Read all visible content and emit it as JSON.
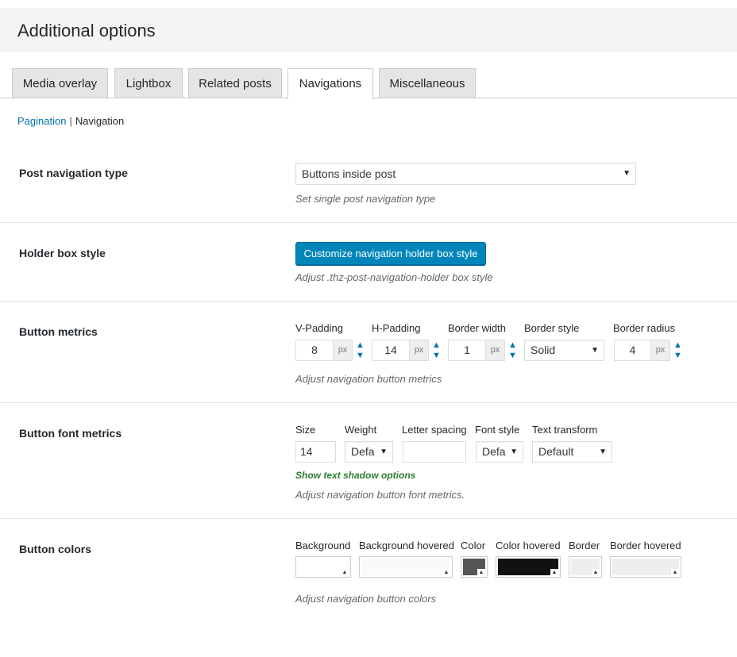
{
  "page_title": "Additional options",
  "tabs": [
    {
      "label": "Media overlay"
    },
    {
      "label": "Lightbox"
    },
    {
      "label": "Related posts"
    },
    {
      "label": "Navigations"
    },
    {
      "label": "Miscellaneous"
    }
  ],
  "subnav": {
    "pagination": "Pagination",
    "separator": "|",
    "navigation": "Navigation"
  },
  "post_nav": {
    "label": "Post navigation type",
    "value": "Buttons inside post",
    "desc": "Set single post navigation type"
  },
  "holder": {
    "label": "Holder box style",
    "button": "Customize navigation holder box style",
    "desc": "Adjust .thz-post-navigation-holder box style"
  },
  "metrics": {
    "label": "Button metrics",
    "vpad_label": "V-Padding",
    "vpad_value": "8",
    "hpad_label": "H-Padding",
    "hpad_value": "14",
    "bw_label": "Border width",
    "bw_value": "1",
    "bs_label": "Border style",
    "bs_value": "Solid",
    "br_label": "Border radius",
    "br_value": "4",
    "unit": "px",
    "desc": "Adjust navigation button metrics"
  },
  "font": {
    "label": "Button font metrics",
    "size_label": "Size",
    "size_value": "14",
    "weight_label": "Weight",
    "weight_value": "Defa",
    "ls_label": "Letter spacing",
    "ls_value": "",
    "style_label": "Font style",
    "style_value": "Defa",
    "tt_label": "Text transform",
    "tt_value": "Default",
    "shadow_link": "Show text shadow options",
    "desc": "Adjust navigation button font metrics."
  },
  "colors": {
    "label": "Button colors",
    "bg_label": "Background",
    "bg_color": "#ffffff",
    "bgh_label": "Background hovered",
    "bgh_color": "#fafafa",
    "color_label": "Color",
    "color_color": "#555555",
    "colorh_label": "Color hovered",
    "colorh_color": "#111111",
    "border_label": "Border",
    "border_color": "#eeeeee",
    "borderh_label": "Border hovered",
    "borderh_color": "#eeeeee",
    "desc": "Adjust navigation button colors"
  },
  "icons": {
    "dropdown": "▼",
    "spin_up": "▲",
    "spin_down": "▼",
    "picker": "▲"
  }
}
